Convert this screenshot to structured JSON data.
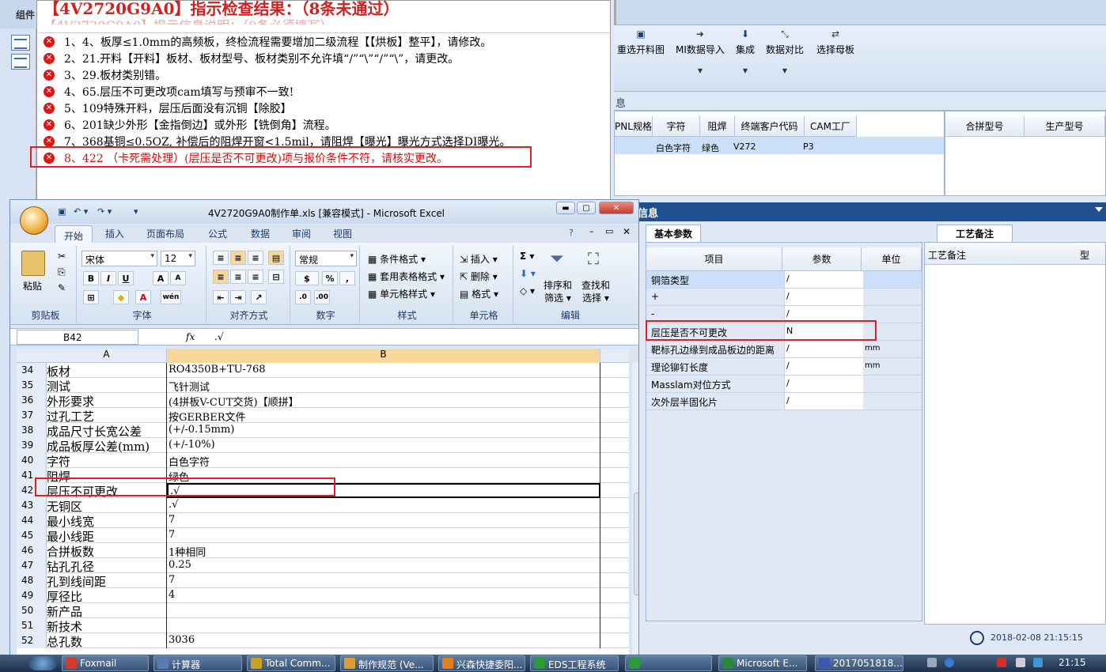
{
  "left_strip": {
    "tab_label": "组件"
  },
  "message_window": {
    "title": "【4V2720G9A0】指示检查结果：（8条未通过）",
    "subtitle": "【4V2720G9A0】提示信息说明：（0条必须填写）",
    "error_icon": "x-circle-icon",
    "items": [
      {
        "text": "1、4、板厚≤1.0mm的高频板，终检流程需要增加二级流程【【烘板】整平】，请修改。",
        "color": "#000000"
      },
      {
        "text": "2、21.开料【开料】板材、板材型号、板材类别不允许填“/”“\\”“/”“\\”，请更改。",
        "color": "#000000"
      },
      {
        "text": "3、29.板材类别错。",
        "color": "#000000"
      },
      {
        "text": "4、65.层压不可更改项cam填写与预审不一致!",
        "color": "#000000"
      },
      {
        "text": "5、109特殊开料，层压后面没有沉铜【除胶】",
        "color": "#000000"
      },
      {
        "text": "6、201缺少外形【金指倒边】或外形【铣倒角】流程。",
        "color": "#000000"
      },
      {
        "text": "7、368基铜≤0.5OZ, 补偿后的阻焊开窗<1.5mil，请阻焊【曝光】曝光方式选择DI曝光。",
        "color": "#000000"
      },
      {
        "text": "8、422 （卡死需处理）(层压是否不可更改)项与报价条件不符，请核实更改。",
        "color": "#d01010"
      }
    ]
  },
  "right_app": {
    "ribbon_buttons": [
      {
        "label": "重选开料图",
        "icon": "image-icon"
      },
      {
        "label": "MI数据导入",
        "icon": "import-icon"
      },
      {
        "label": "集成",
        "icon": "download-icon"
      },
      {
        "label": "数据对比",
        "icon": "compare-icon"
      },
      {
        "label": "选择母板",
        "icon": "shuffle-icon"
      }
    ],
    "info_header": "息",
    "table1": {
      "headers": [
        "PNL规格",
        "字符",
        "阻焊",
        "终端客户代码",
        "CAM工厂"
      ],
      "row": [
        "",
        "白色字符",
        "绿色",
        "V272",
        "P3"
      ]
    },
    "table2": {
      "headers": [
        "合拼型号",
        "生产型号"
      ]
    },
    "section_header": "信息",
    "basic_tab": "基本参数",
    "basic_headers": [
      "项目",
      "参数",
      "单位"
    ],
    "basic_rows": [
      {
        "item": "铜箔类型",
        "value": "/",
        "unit": ""
      },
      {
        "item": "+",
        "value": "/",
        "unit": ""
      },
      {
        "item": "-",
        "value": "/",
        "unit": ""
      },
      {
        "item": "层压是否不可更改",
        "value": "N",
        "unit": ""
      },
      {
        "item": "靶标孔边缘到成品板边的距离",
        "value": "/",
        "unit": "mm"
      },
      {
        "item": "理论铆钉长度",
        "value": "/",
        "unit": "mm"
      },
      {
        "item": "Masslam对位方式",
        "value": "/",
        "unit": ""
      },
      {
        "item": "次外层半固化片",
        "value": "/",
        "unit": ""
      }
    ],
    "notes_tab": "工艺备注",
    "notes_header": "工艺备注",
    "notes_col2": "型",
    "status_time": "2018-02-08 21:15:15"
  },
  "excel": {
    "title": "4V2720G9A0制作单.xls  [兼容模式] - Microsoft Excel",
    "tabs": [
      "开始",
      "插入",
      "页面布局",
      "公式",
      "数据",
      "审阅",
      "视图"
    ],
    "font_name": "宋体",
    "font_size": "12",
    "number_format": "常规",
    "groups": [
      "剪贴板",
      "字体",
      "对齐方式",
      "数字",
      "样式",
      "单元格",
      "编辑"
    ],
    "paste_label": "粘贴",
    "style_buttons": [
      "条件格式",
      "套用表格格式",
      "单元格样式"
    ],
    "cell_buttons": [
      "插入",
      "删除",
      "格式"
    ],
    "edit_buttons": [
      "排序和\n筛选",
      "查找和\n选择"
    ],
    "name_box": "B42",
    "formula_value": ".√",
    "columns": [
      "A",
      "B"
    ],
    "rows": [
      {
        "n": "34",
        "a": "板材",
        "b": "RO4350B+TU-768"
      },
      {
        "n": "35",
        "a": "测试",
        "b": "飞针测试"
      },
      {
        "n": "36",
        "a": "外形要求",
        "b": "(4拼板V-CUT交货)【顺拼】"
      },
      {
        "n": "37",
        "a": "过孔工艺",
        "b": "按GERBER文件"
      },
      {
        "n": "38",
        "a": "成品尺寸长宽公差",
        "b": "(+/-0.15mm)"
      },
      {
        "n": "39",
        "a": "成品板厚公差(mm)",
        "b": "(+/-10%)"
      },
      {
        "n": "40",
        "a": "字符",
        "b": "白色字符"
      },
      {
        "n": "41",
        "a": "阻焊",
        "b": "绿色"
      },
      {
        "n": "42",
        "a": "层压不可更改",
        "b": ".√"
      },
      {
        "n": "43",
        "a": "无铜区",
        "b": ".√"
      },
      {
        "n": "44",
        "a": "最小线宽",
        "b": "7"
      },
      {
        "n": "45",
        "a": "最小线距",
        "b": "7"
      },
      {
        "n": "46",
        "a": "合拼板数",
        "b": "1种相同"
      },
      {
        "n": "47",
        "a": "钻孔孔径",
        "b": "0.25"
      },
      {
        "n": "48",
        "a": "孔到线间距",
        "b": "7"
      },
      {
        "n": "49",
        "a": "厚径比",
        "b": "4"
      },
      {
        "n": "50",
        "a": "新产品",
        "b": ""
      },
      {
        "n": "51",
        "a": "新技术",
        "b": ""
      },
      {
        "n": "52",
        "a": "总孔数",
        "b": "3036"
      }
    ],
    "selected_row": "42"
  },
  "taskbar": {
    "items": [
      {
        "label": "Foxmail",
        "color": "#d83a2a"
      },
      {
        "label": "计算器",
        "color": "#5a7ab0"
      },
      {
        "label": "Total Comm...",
        "color": "#c9a020"
      },
      {
        "label": "制作规范 (Ve...",
        "color": "#d8a030"
      },
      {
        "label": "兴森快捷委阳...",
        "color": "#e08020"
      },
      {
        "label": "EDS工程系统",
        "color": "#2a9a3a"
      },
      {
        "label": "",
        "color": "#2a9a3a"
      },
      {
        "label": "Microsoft E...",
        "color": "#2a8a3a"
      },
      {
        "label": "2017051818...",
        "color": "#3a5ab0"
      }
    ],
    "clock": "21:15"
  }
}
